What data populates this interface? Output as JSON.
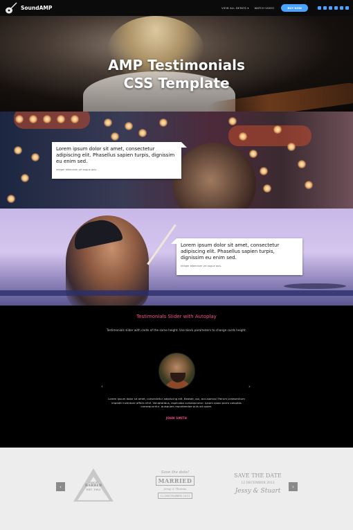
{
  "nav": {
    "brand": "SoundAMP",
    "links": [
      "VIEW ALL DEMOS ▾",
      "WATCH VIDEO"
    ],
    "buy_label": "BUY NOW",
    "social_icons": [
      "instagram-icon",
      "facebook-icon",
      "twitter-icon",
      "google-plus-icon",
      "linkedin-icon",
      "youtube-icon"
    ]
  },
  "hero": {
    "title_line1": "AMP Testimonials",
    "title_line2": "CSS Template"
  },
  "testimonial_cards": [
    {
      "text": "Lorem ipsum dolor sit amet, consectetur adipiscing elit. Phasellus sapien turpis, dignissim eu enim sed.",
      "sub": "Integer bibendum vel augue quis."
    },
    {
      "text": "Lorem ipsum dolor sit amet, consectetur adipiscing elit. Phasellus sapien turpis, dignissim eu enim sed.",
      "sub": "Integer bibendum vel augue quis."
    }
  ],
  "slider": {
    "title": "Testimonials Slider with Autoplay",
    "description": "Testimonials slider with cards of the same height. Use block parameters to change cards height.",
    "quote": "Lorem ipsum dolor sit amet, consectetur adipiscing elit. Beatae, qui, accusamus! Rerum praesentium impedit inventore officia nihil. Voluptatibus, explicabo consequuntur. Ipsam quasi porro voluptas consequuntur, quisquam repudiandae quis ad quam.",
    "author": "JOHN SMITH",
    "prev": "‹",
    "next": "›"
  },
  "clients": {
    "prev": "‹",
    "next": "›",
    "badge1": {
      "line1": "SHOP",
      "line2": "BARBER",
      "line3": "EST. 1983"
    },
    "badge2": {
      "line1": "Save the date!",
      "line2": "MARRIED",
      "line3": "Jessy & Thomas",
      "line4": "12 DECEMBER 2013"
    },
    "badge3": {
      "line1": "SAVE THE DATE",
      "line2": "12 DECEMBER 2013",
      "line3": "Jessy & Stuart"
    }
  },
  "colors": {
    "accent": "#ff4d94",
    "button": "#4aa3ff"
  }
}
